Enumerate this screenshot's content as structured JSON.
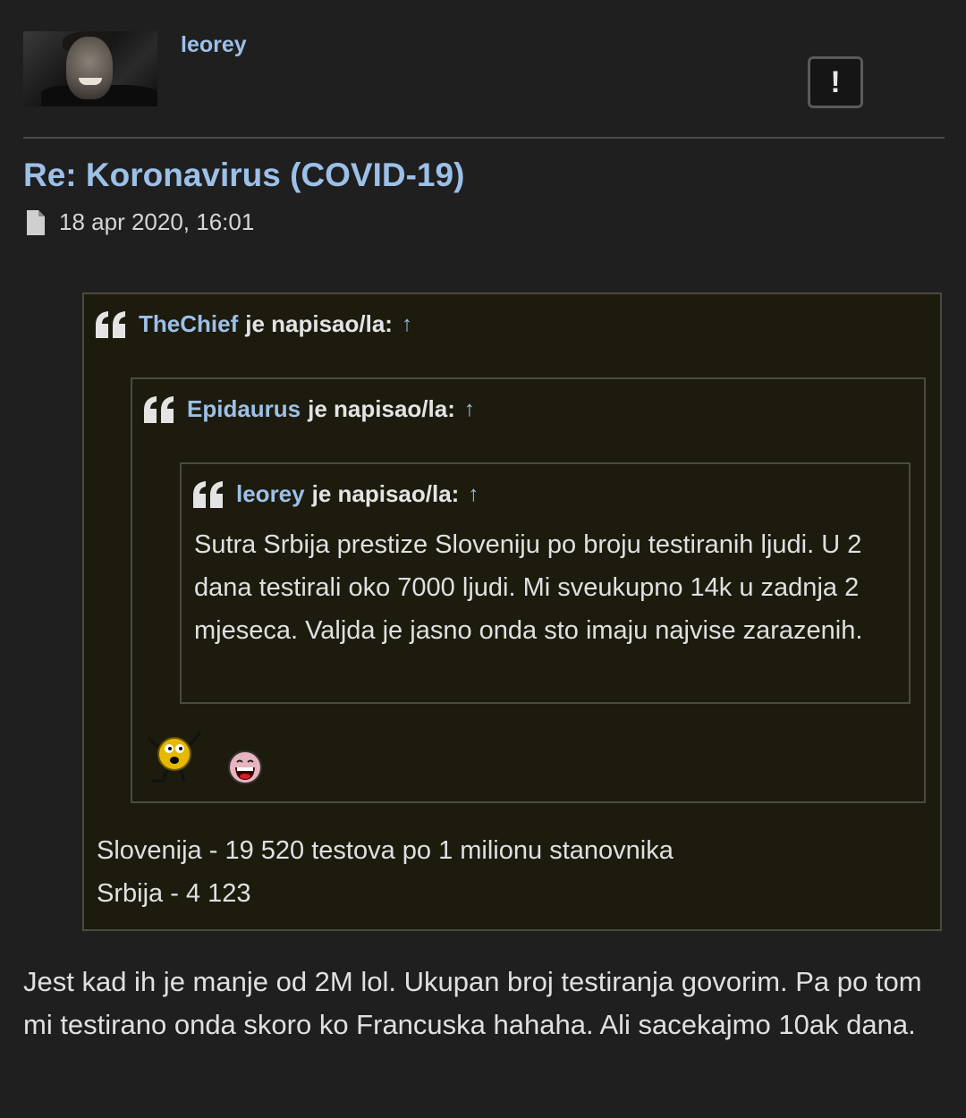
{
  "author": {
    "username": "leorey"
  },
  "post": {
    "title": "Re: Koronavirus (COVID-19)",
    "date": "18 apr 2020, 16:01",
    "report_label": "!",
    "quote_outer": {
      "author": "TheChief",
      "suffix": "je napisao/la:",
      "arrow": "↑",
      "lines": [
        "Slovenija - 19 520 testova po 1 milionu stanovnika",
        "Srbija - 4 123"
      ]
    },
    "quote_middle": {
      "author": "Epidaurus",
      "suffix": "je napisao/la:",
      "arrow": "↑"
    },
    "quote_inner": {
      "author": "leorey",
      "suffix": "je napisao/la:",
      "arrow": "↑",
      "text": "Sutra Srbija prestize Sloveniju po broju testiranih ljudi. U 2 dana testirali oko 7000 ljudi. Mi sveukupno 14k u zadnja 2 mjeseca. Valjda je jasno onda sto imaju najvise zarazenih."
    },
    "body": "Jest kad ih je manje od 2M lol. Ukupan broj testiranja govorim. Pa po tom mi testirano onda skoro ko Francuska hahaha. Ali sacekajmo 10ak dana."
  },
  "colors": {
    "link": "#9cc0e8",
    "quote_bg": "#1c1b0e",
    "quote_border": "#4b4a40",
    "page_bg": "#1f1f1f"
  }
}
